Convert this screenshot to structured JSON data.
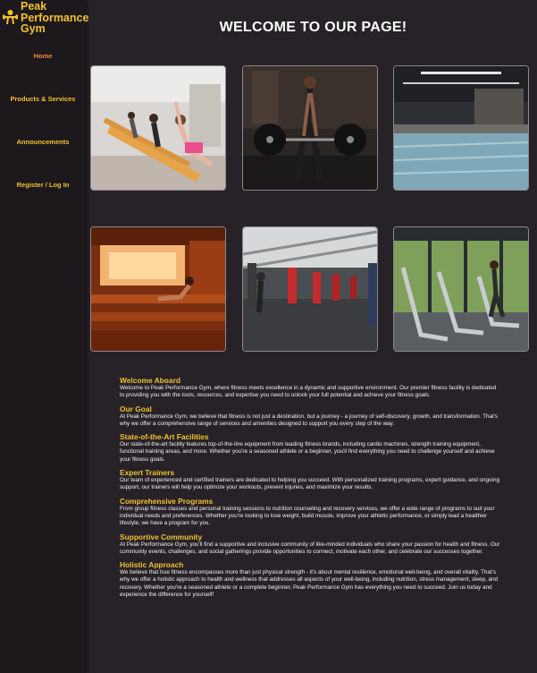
{
  "brand": {
    "name": "Peak\nPerformance\nGym",
    "icon": "gym-logo-icon"
  },
  "nav": {
    "items": [
      {
        "label": "Home",
        "active": true
      },
      {
        "label": "Products & Services"
      },
      {
        "label": "Announcements"
      },
      {
        "label": "Register / Log In"
      }
    ]
  },
  "page": {
    "title": "WELCOME TO OUR PAGE!"
  },
  "gallery": [
    {
      "name": "pilates-class-photo"
    },
    {
      "name": "deadlift-athlete-photo"
    },
    {
      "name": "indoor-pool-photo"
    },
    {
      "name": "sauna-room-photo"
    },
    {
      "name": "boxing-gym-photo"
    },
    {
      "name": "treadmill-area-photo"
    }
  ],
  "sections": [
    {
      "heading": "Welcome Aboard",
      "body": "Welcome to Peak Performance Gym, where fitness meets excellence in a dynamic and supportive environment. Our premier fitness facility is dedicated to providing you with the tools, resources, and expertise you need to unlock your full potential and achieve your fitness goals."
    },
    {
      "heading": "Our Goal",
      "body": "At Peak Performance Gym, we believe that fitness is not just a destination, but a journey - a journey of self-discovery, growth, and transformation. That's why we offer a comprehensive range of services and amenities designed to support you every step of the way."
    },
    {
      "heading": "State-of-the-Art Facilities",
      "body": "Our state-of-the-art facility features top-of-the-line equipment from leading fitness brands, including cardio machines, strength training equipment, functional training areas, and more. Whether you're a seasoned athlete or a beginner, you'll find everything you need to challenge yourself and achieve your fitness goals."
    },
    {
      "heading": "Expert Trainers",
      "body": "Our team of experienced and certified trainers are dedicated to helping you succeed. With personalized training programs, expert guidance, and ongoing support, our trainers will help you optimize your workouts, prevent injuries, and maximize your results."
    },
    {
      "heading": "Comprehensive Programs",
      "body": "From group fitness classes and personal training sessions to nutrition counseling and recovery services, we offer a wide range of programs to suit your individual needs and preferences. Whether you're looking to lose weight, build muscle, improve your athletic performance, or simply lead a healthier lifestyle, we have a program for you."
    },
    {
      "heading": "Supportive Community",
      "body": "At Peak Performance Gym, you'll find a supportive and inclusive community of like-minded individuals who share your passion for health and fitness. Our community events, challenges, and social gatherings provide opportunities to connect, motivate each other, and celebrate our successes together."
    },
    {
      "heading": "Holistic Approach",
      "body": "We believe that true fitness encompasses more than just physical strength - it's about mental resilience, emotional well-being, and overall vitality. That's why we offer a holistic approach to health and wellness that addresses all aspects of your well-being, including nutrition, stress management, sleep, and recovery. Whether you're a seasoned athlete or a complete beginner, Peak Performance Gym has everything you need to succeed. Join us today and experience the difference for yourself!"
    }
  ],
  "colors": {
    "accent": "#f2c12e",
    "active": "#ef8a3a",
    "background": "#272228",
    "sidebar": "#1c181c"
  }
}
